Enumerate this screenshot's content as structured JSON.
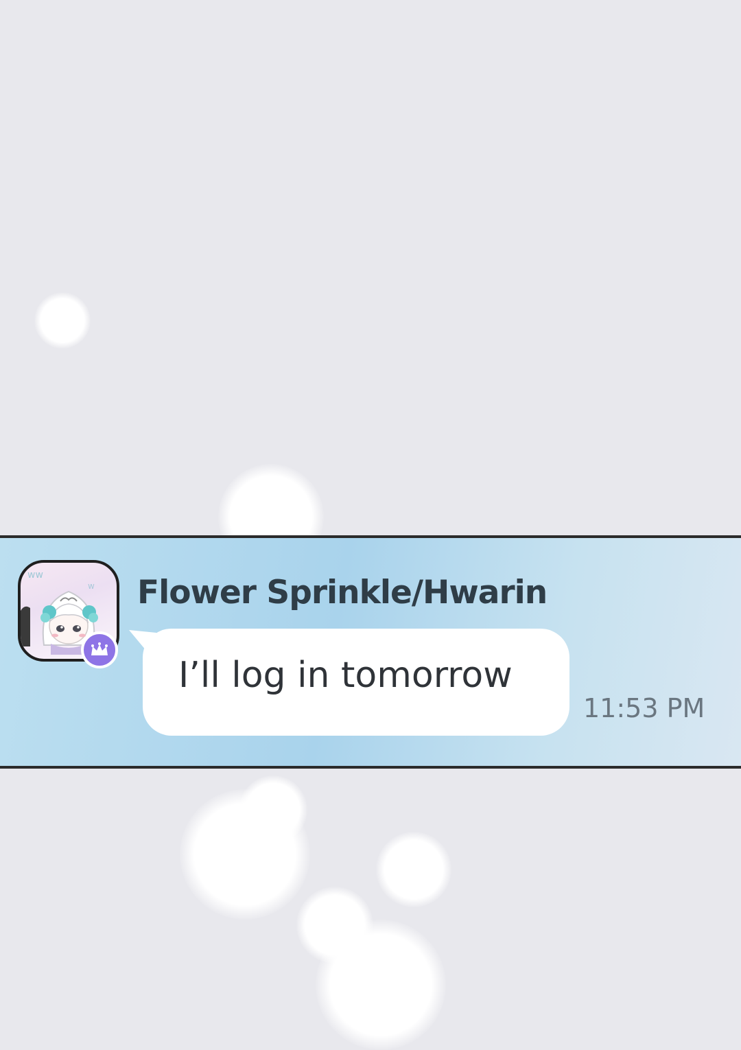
{
  "message": {
    "sender_name": "Flower Sprinkle/Hwarin",
    "text": "I’ll log in tomorrow",
    "time": "11:53 PM",
    "avatar_icon": "anime-girl-avatar",
    "badge_icon": "crown-icon"
  },
  "colors": {
    "background": "#e8e8ed",
    "strip": "#a9d3ec",
    "bubble": "#ffffff",
    "badge": "#8e74e6",
    "name_text": "#2f3d47",
    "time_text": "#6a7680"
  }
}
